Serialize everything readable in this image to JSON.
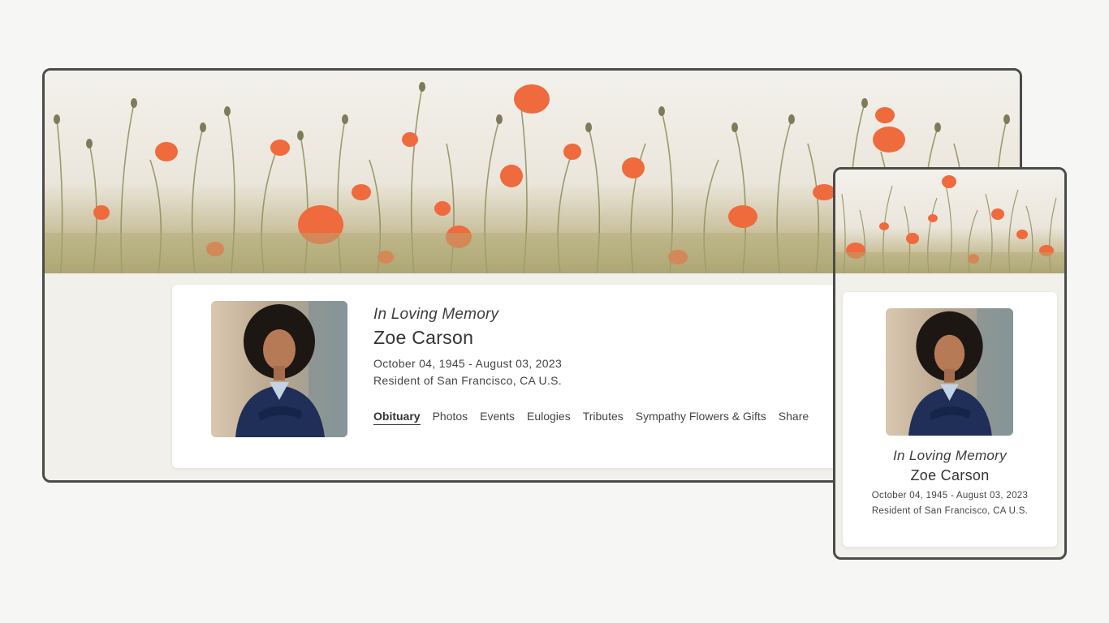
{
  "profile": {
    "tagline": "In Loving Memory",
    "name": "Zoe Carson",
    "dates": "October 04, 1945 - August 03, 2023",
    "resident": "Resident of San Francisco, CA U.S."
  },
  "nav": {
    "tabs": [
      {
        "label": "Obituary",
        "active": true
      },
      {
        "label": "Photos"
      },
      {
        "label": "Events"
      },
      {
        "label": "Eulogies"
      },
      {
        "label": "Tributes"
      },
      {
        "label": "Sympathy Flowers & Gifts"
      },
      {
        "label": "Share"
      }
    ]
  },
  "colors": {
    "frame_border": "#4b4b47",
    "page_background": "#f6f6f5",
    "poppy": "#ef6a3c",
    "card": "#ffffff"
  }
}
